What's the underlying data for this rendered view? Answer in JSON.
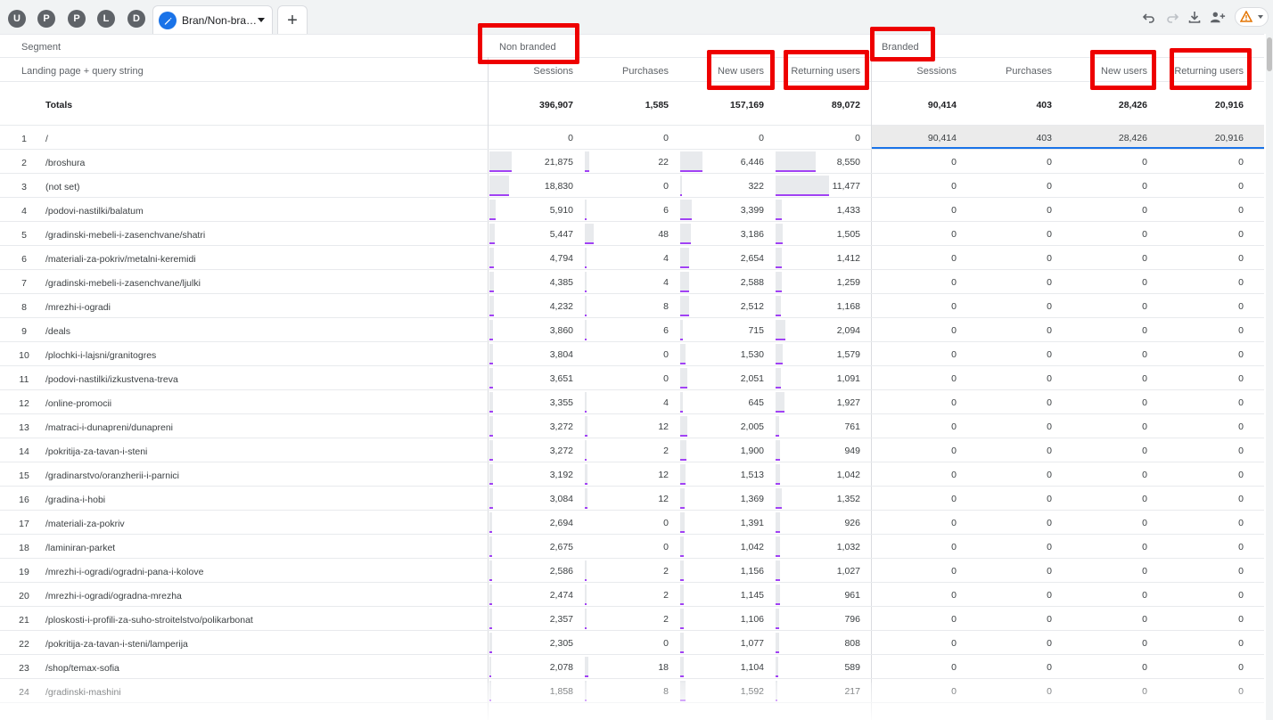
{
  "tabs": {
    "avatars": [
      "U",
      "P",
      "P",
      "L",
      "D"
    ],
    "active_label": "Bran/Non-bra…",
    "add_label": "+"
  },
  "toolbar": {
    "icons": [
      "undo-icon",
      "redo-icon",
      "download-icon",
      "share-icon",
      "warning-icon"
    ]
  },
  "table": {
    "segment_label": "Segment",
    "dimension_label": "Landing page + query string",
    "segments": [
      "Non branded",
      "Branded"
    ],
    "metrics": [
      "Sessions",
      "Purchases",
      "New users",
      "Returning users"
    ],
    "totals_label": "Totals",
    "totals": {
      "non_branded": [
        "396,907",
        "1,585",
        "157,169",
        "89,072"
      ],
      "branded": [
        "90,414",
        "403",
        "28,426",
        "20,916"
      ]
    },
    "rows": [
      {
        "n": "1",
        "page": "/",
        "nb": [
          "0",
          "0",
          "0",
          "0"
        ],
        "b": [
          "90,414",
          "403",
          "28,426",
          "20,916"
        ]
      },
      {
        "n": "2",
        "page": "/broshura",
        "nb": [
          "21,875",
          "22",
          "6,446",
          "8,550"
        ],
        "b": [
          "0",
          "0",
          "0",
          "0"
        ]
      },
      {
        "n": "3",
        "page": "(not set)",
        "nb": [
          "18,830",
          "0",
          "322",
          "11,477"
        ],
        "b": [
          "0",
          "0",
          "0",
          "0"
        ]
      },
      {
        "n": "4",
        "page": "/podovi-nastilki/balatum",
        "nb": [
          "5,910",
          "6",
          "3,399",
          "1,433"
        ],
        "b": [
          "0",
          "0",
          "0",
          "0"
        ]
      },
      {
        "n": "5",
        "page": "/gradinski-mebeli-i-zasenchvane/shatri",
        "nb": [
          "5,447",
          "48",
          "3,186",
          "1,505"
        ],
        "b": [
          "0",
          "0",
          "0",
          "0"
        ]
      },
      {
        "n": "6",
        "page": "/materiali-za-pokriv/metalni-keremidi",
        "nb": [
          "4,794",
          "4",
          "2,654",
          "1,412"
        ],
        "b": [
          "0",
          "0",
          "0",
          "0"
        ]
      },
      {
        "n": "7",
        "page": "/gradinski-mebeli-i-zasenchvane/ljulki",
        "nb": [
          "4,385",
          "4",
          "2,588",
          "1,259"
        ],
        "b": [
          "0",
          "0",
          "0",
          "0"
        ]
      },
      {
        "n": "8",
        "page": "/mrezhi-i-ogradi",
        "nb": [
          "4,232",
          "8",
          "2,512",
          "1,168"
        ],
        "b": [
          "0",
          "0",
          "0",
          "0"
        ]
      },
      {
        "n": "9",
        "page": "/deals",
        "nb": [
          "3,860",
          "6",
          "715",
          "2,094"
        ],
        "b": [
          "0",
          "0",
          "0",
          "0"
        ]
      },
      {
        "n": "10",
        "page": "/plochki-i-lajsni/granitogres",
        "nb": [
          "3,804",
          "0",
          "1,530",
          "1,579"
        ],
        "b": [
          "0",
          "0",
          "0",
          "0"
        ]
      },
      {
        "n": "11",
        "page": "/podovi-nastilki/izkustvena-treva",
        "nb": [
          "3,651",
          "0",
          "2,051",
          "1,091"
        ],
        "b": [
          "0",
          "0",
          "0",
          "0"
        ]
      },
      {
        "n": "12",
        "page": "/online-promocii",
        "nb": [
          "3,355",
          "4",
          "645",
          "1,927"
        ],
        "b": [
          "0",
          "0",
          "0",
          "0"
        ]
      },
      {
        "n": "13",
        "page": "/matraci-i-dunapreni/dunapreni",
        "nb": [
          "3,272",
          "12",
          "2,005",
          "761"
        ],
        "b": [
          "0",
          "0",
          "0",
          "0"
        ]
      },
      {
        "n": "14",
        "page": "/pokritija-za-tavan-i-steni",
        "nb": [
          "3,272",
          "2",
          "1,900",
          "949"
        ],
        "b": [
          "0",
          "0",
          "0",
          "0"
        ]
      },
      {
        "n": "15",
        "page": "/gradinarstvo/oranzherii-i-parnici",
        "nb": [
          "3,192",
          "12",
          "1,513",
          "1,042"
        ],
        "b": [
          "0",
          "0",
          "0",
          "0"
        ]
      },
      {
        "n": "16",
        "page": "/gradina-i-hobi",
        "nb": [
          "3,084",
          "12",
          "1,369",
          "1,352"
        ],
        "b": [
          "0",
          "0",
          "0",
          "0"
        ]
      },
      {
        "n": "17",
        "page": "/materiali-za-pokriv",
        "nb": [
          "2,694",
          "0",
          "1,391",
          "926"
        ],
        "b": [
          "0",
          "0",
          "0",
          "0"
        ]
      },
      {
        "n": "18",
        "page": "/laminiran-parket",
        "nb": [
          "2,675",
          "0",
          "1,042",
          "1,032"
        ],
        "b": [
          "0",
          "0",
          "0",
          "0"
        ]
      },
      {
        "n": "19",
        "page": "/mrezhi-i-ogradi/ogradni-pana-i-kolove",
        "nb": [
          "2,586",
          "2",
          "1,156",
          "1,027"
        ],
        "b": [
          "0",
          "0",
          "0",
          "0"
        ]
      },
      {
        "n": "20",
        "page": "/mrezhi-i-ogradi/ogradna-mrezha",
        "nb": [
          "2,474",
          "2",
          "1,145",
          "961"
        ],
        "b": [
          "0",
          "0",
          "0",
          "0"
        ]
      },
      {
        "n": "21",
        "page": "/ploskosti-i-profili-za-suho-stroitelstvo/polikarbonat",
        "nb": [
          "2,357",
          "2",
          "1,106",
          "796"
        ],
        "b": [
          "0",
          "0",
          "0",
          "0"
        ]
      },
      {
        "n": "22",
        "page": "/pokritija-za-tavan-i-steni/lamperija",
        "nb": [
          "2,305",
          "0",
          "1,077",
          "808"
        ],
        "b": [
          "0",
          "0",
          "0",
          "0"
        ]
      },
      {
        "n": "23",
        "page": "/shop/temax-sofia",
        "nb": [
          "2,078",
          "18",
          "1,104",
          "589"
        ],
        "b": [
          "0",
          "0",
          "0",
          "0"
        ]
      },
      {
        "n": "24",
        "page": "/gradinski-mashini",
        "nb": [
          "1,858",
          "8",
          "1,592",
          "217"
        ],
        "b": [
          "0",
          "0",
          "0",
          "0"
        ]
      }
    ]
  },
  "colors": {
    "accent_bar": "#a142f4",
    "highlight": "#ee0000",
    "selection_line": "#1a73e8"
  }
}
